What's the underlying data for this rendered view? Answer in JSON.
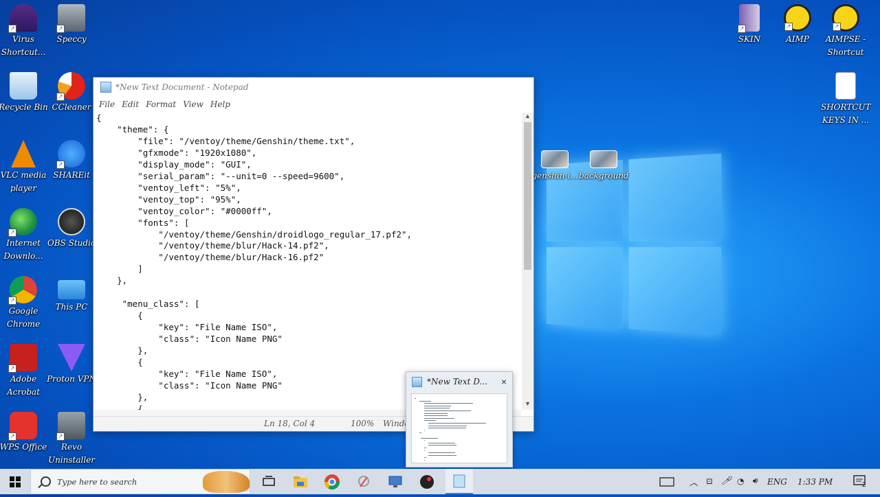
{
  "desktop": {
    "left_icons": [
      {
        "label": "Virus Shortcut...",
        "icon": "virus-shortcut-icon"
      },
      {
        "label": "Speccy",
        "icon": "speccy-icon"
      },
      {
        "label": "Recycle Bin",
        "icon": "recycle-bin-icon"
      },
      {
        "label": "CCleaner",
        "icon": "ccleaner-icon"
      },
      {
        "label": "VLC media player",
        "icon": "vlc-icon"
      },
      {
        "label": "SHAREit",
        "icon": "shareit-icon"
      },
      {
        "label": "Internet Downlo...",
        "icon": "idm-icon"
      },
      {
        "label": "OBS Studio",
        "icon": "obs-icon"
      },
      {
        "label": "Google Chrome",
        "icon": "chrome-icon"
      },
      {
        "label": "This PC",
        "icon": "this-pc-icon"
      },
      {
        "label": "Adobe Acrobat",
        "icon": "acrobat-icon"
      },
      {
        "label": "Proton VPN",
        "icon": "protonvpn-icon"
      },
      {
        "label": "WPS Office",
        "icon": "wps-icon"
      },
      {
        "label": "Revo Uninstaller",
        "icon": "revo-icon"
      }
    ],
    "right_icons": [
      {
        "label": "SKIN",
        "icon": "skin-folder-icon"
      },
      {
        "label": "AIMP",
        "icon": "aimp-icon"
      },
      {
        "label": "AIMPSE - Shortcut",
        "icon": "aimpse-icon"
      },
      {
        "label": "SHORTCUT KEYS IN ...",
        "icon": "text-file-icon"
      },
      {
        "label": "genshin-i...",
        "icon": "image-file-icon"
      },
      {
        "label": "background",
        "icon": "image-file-icon"
      }
    ]
  },
  "notepad": {
    "title": "*New Text Document - Notepad",
    "menu": [
      "File",
      "Edit",
      "Format",
      "View",
      "Help"
    ],
    "lines": [
      "{",
      "    \"theme\": {",
      "        \"file\": \"/ventoy/theme/Genshin/theme.txt\",",
      "        \"gfxmode\": \"1920x1080\",",
      "        \"display_mode\": \"GUI\",",
      "        \"serial_param\": \"--unit=0 --speed=9600\",",
      "        \"ventoy_left\": \"5%\",",
      "        \"ventoy_top\": \"95%\",",
      "        \"ventoy_color\": \"#0000ff\",",
      "        \"fonts\": [",
      "            \"/ventoy/theme/Genshin/droidlogo_regular_17.pf2\",",
      "            \"/ventoy/theme/blur/Hack-14.pf2\",",
      "            \"/ventoy/theme/blur/Hack-16.pf2\"",
      "        ]",
      "    },",
      "",
      "     \"menu_class\": [",
      "        {",
      "            \"key\": \"File Name ISO\",",
      "            \"class\": \"Icon Name PNG\"",
      "        },",
      "        {",
      "            \"key\": \"File Name ISO\",",
      "            \"class\": \"Icon Name PNG\"",
      "        },",
      "        {"
    ],
    "status": {
      "position": "Ln 18, Col 4",
      "zoom": "100%",
      "eol": "Windo"
    }
  },
  "preview": {
    "title": "*New Text D...",
    "close": "×"
  },
  "taskbar": {
    "search_placeholder": "Type here to search",
    "language": "ENG",
    "time": "1:33 PM",
    "notification_count": "2"
  },
  "colors": {
    "accent": "#0a72e0",
    "taskbar": "#d6dde6"
  }
}
